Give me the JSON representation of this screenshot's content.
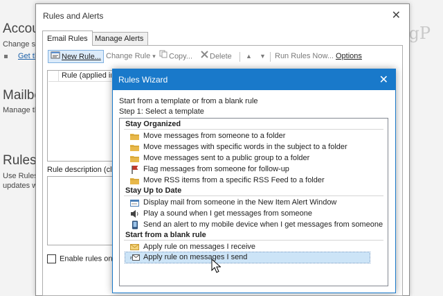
{
  "background": {
    "account_heading": "Accou",
    "account_text": "Change se",
    "account_link": "Get th",
    "mailbox_heading": "Mailbo",
    "mailbox_text": "Manage th",
    "rules_heading": "Rules a",
    "rules_text_1": "Use Rules",
    "rules_text_2": "updates w",
    "watermark": "gP"
  },
  "rules_dialog": {
    "title": "Rules and Alerts",
    "close_glyph": "✕",
    "tabs": [
      {
        "label": "Email Rules"
      },
      {
        "label": "Manage Alerts"
      }
    ],
    "toolbar": {
      "new_rule": "New Rule...",
      "change_rule": "Change Rule",
      "change_rule_arrow": "▾",
      "copy": "Copy...",
      "delete": "Delete",
      "move_up": "▲",
      "move_down": "▼",
      "run_rules": "Run Rules Now...",
      "options": "Options"
    },
    "list_header": "Rule (applied in t",
    "description_label": "Rule description (cli",
    "enable_label": "Enable rules on a"
  },
  "wizard": {
    "title": "Rules Wizard",
    "close_glyph": "✕",
    "intro": "Start from a template or from a blank rule",
    "step": "Step 1: Select a template",
    "groups": [
      {
        "title": "Stay Organized",
        "items": [
          {
            "label": "Move messages from someone to a folder",
            "icon": "folder-icon"
          },
          {
            "label": "Move messages with specific words in the subject to a folder",
            "icon": "folder-icon"
          },
          {
            "label": "Move messages sent to a public group to a folder",
            "icon": "folder-icon"
          },
          {
            "label": "Flag messages from someone for follow-up",
            "icon": "flag-icon"
          },
          {
            "label": "Move RSS items from a specific RSS Feed to a folder",
            "icon": "folder-icon"
          }
        ]
      },
      {
        "title": "Stay Up to Date",
        "items": [
          {
            "label": "Display mail from someone in the New Item Alert Window",
            "icon": "alert-window-icon"
          },
          {
            "label": "Play a sound when I get messages from someone",
            "icon": "speaker-icon"
          },
          {
            "label": "Send an alert to my mobile device when I get messages from someone",
            "icon": "mobile-icon"
          }
        ]
      },
      {
        "title": "Start from a blank rule",
        "items": [
          {
            "label": "Apply rule on messages I receive",
            "icon": "envelope-icon"
          },
          {
            "label": "Apply rule on messages I send",
            "icon": "send-icon",
            "selected": true
          }
        ]
      }
    ]
  },
  "colors": {
    "wizard_titlebar": "#1979ca",
    "selection": "#cce4f7",
    "folder": "#e8b84a",
    "flag": "#c0392b"
  }
}
